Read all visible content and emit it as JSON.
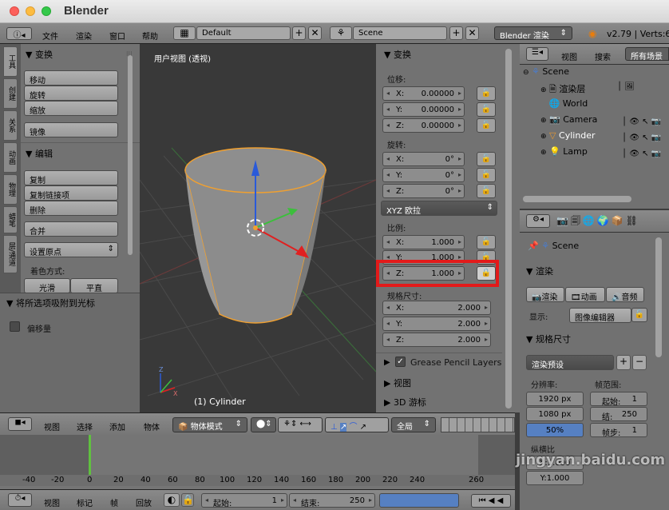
{
  "window": {
    "title": "Blender"
  },
  "info_bar": {
    "menus": [
      "文件",
      "渲染",
      "窗口",
      "帮助"
    ],
    "screen_layout": "Default",
    "scene": "Scene",
    "render_engine": "Blender 渲染",
    "version": "v2.79 | Verts:6"
  },
  "tool_shelf": {
    "tabs": [
      "工具",
      "创建",
      "关系",
      "动画",
      "物理",
      "蜡笔",
      "层/通道"
    ],
    "transform": {
      "header": "▼ 变换",
      "buttons": [
        "移动",
        "旋转",
        "缩放"
      ],
      "mirror": "镜像"
    },
    "edit": {
      "header": "▼ 编辑",
      "buttons": [
        "复制",
        "复制链接项",
        "删除"
      ],
      "join": "合并",
      "set_origin": "设置原点"
    },
    "shading": {
      "label": "着色方式:",
      "smooth": "光滑",
      "flat": "平直"
    },
    "operator": {
      "header": "▼ 将所选项吸附到光标",
      "checkbox_label": "偏移量"
    }
  },
  "viewport": {
    "view_label": "用户视图 (透视)",
    "object_label": "(1) Cylinder"
  },
  "n_panel": {
    "header": "▼ 变换",
    "location": {
      "label": "位移:",
      "x": "0.00000",
      "y": "0.00000",
      "z": "0.00000"
    },
    "rotation": {
      "label": "旋转:",
      "x": "0°",
      "y": "0°",
      "z": "0°",
      "mode": "XYZ 欧拉"
    },
    "scale": {
      "label": "比例:",
      "x": "1.000",
      "y": "1.000",
      "z": "1.000"
    },
    "dimensions": {
      "label": "规格尺寸:",
      "x": "2.000",
      "y": "2.000",
      "z": "2.000"
    },
    "axes": {
      "x": "X:",
      "y": "Y:",
      "z": "Z:"
    },
    "grease_pencil": "Grease Pencil Layers",
    "view": "▶ 视图",
    "cursor": "▶ 3D 游标"
  },
  "viewport_header": {
    "menus": [
      "视图",
      "选择",
      "添加",
      "物体"
    ],
    "mode": "物体模式",
    "pivot": "全局"
  },
  "timeline": {
    "ticks": [
      "-40",
      "-20",
      "0",
      "20",
      "40",
      "60",
      "80",
      "100",
      "120",
      "140",
      "160",
      "180",
      "200",
      "220",
      "240",
      "260"
    ],
    "current_frame": "0"
  },
  "timeline_header": {
    "menus": [
      "视图",
      "标记",
      "帧",
      "回放"
    ],
    "start": "起始:",
    "start_value": "1",
    "end": "结束:",
    "end_value": "250"
  },
  "outliner": {
    "view": "视图",
    "search": "搜索",
    "filter": "所有场景",
    "items": [
      {
        "name": "Scene"
      },
      {
        "name": "渲染层"
      },
      {
        "name": "World"
      },
      {
        "name": "Camera"
      },
      {
        "name": "Cylinder"
      },
      {
        "name": "Lamp"
      }
    ]
  },
  "properties": {
    "scene": "Scene",
    "render": {
      "header": "▼ 渲染",
      "render_btn": "渲染",
      "anim_btn": "动画",
      "audio_btn": "音频",
      "display_label": "显示:",
      "display_value": "图像编辑器"
    },
    "dimensions": {
      "header": "▼ 规格尺寸",
      "preset": "渲染预设",
      "resolution_label": "分辨率:",
      "res_x": "1920 px",
      "res_y": "1080 px",
      "percent": "50%",
      "frame_range_label": "帧范围:",
      "start": "起始:",
      "start_val": "1",
      "end": "结:",
      "end_val": "250",
      "step": "帧步:",
      "step_val": "1",
      "aspect_label": "纵横比",
      "aspect_x": "X:1.000",
      "aspect_y": "Y:1.000"
    }
  },
  "watermark": "jingyan.baidu.com",
  "colors": {
    "accent": "#5680c2",
    "highlight": "#e21a1a",
    "selected_outline": "#f0a030"
  }
}
